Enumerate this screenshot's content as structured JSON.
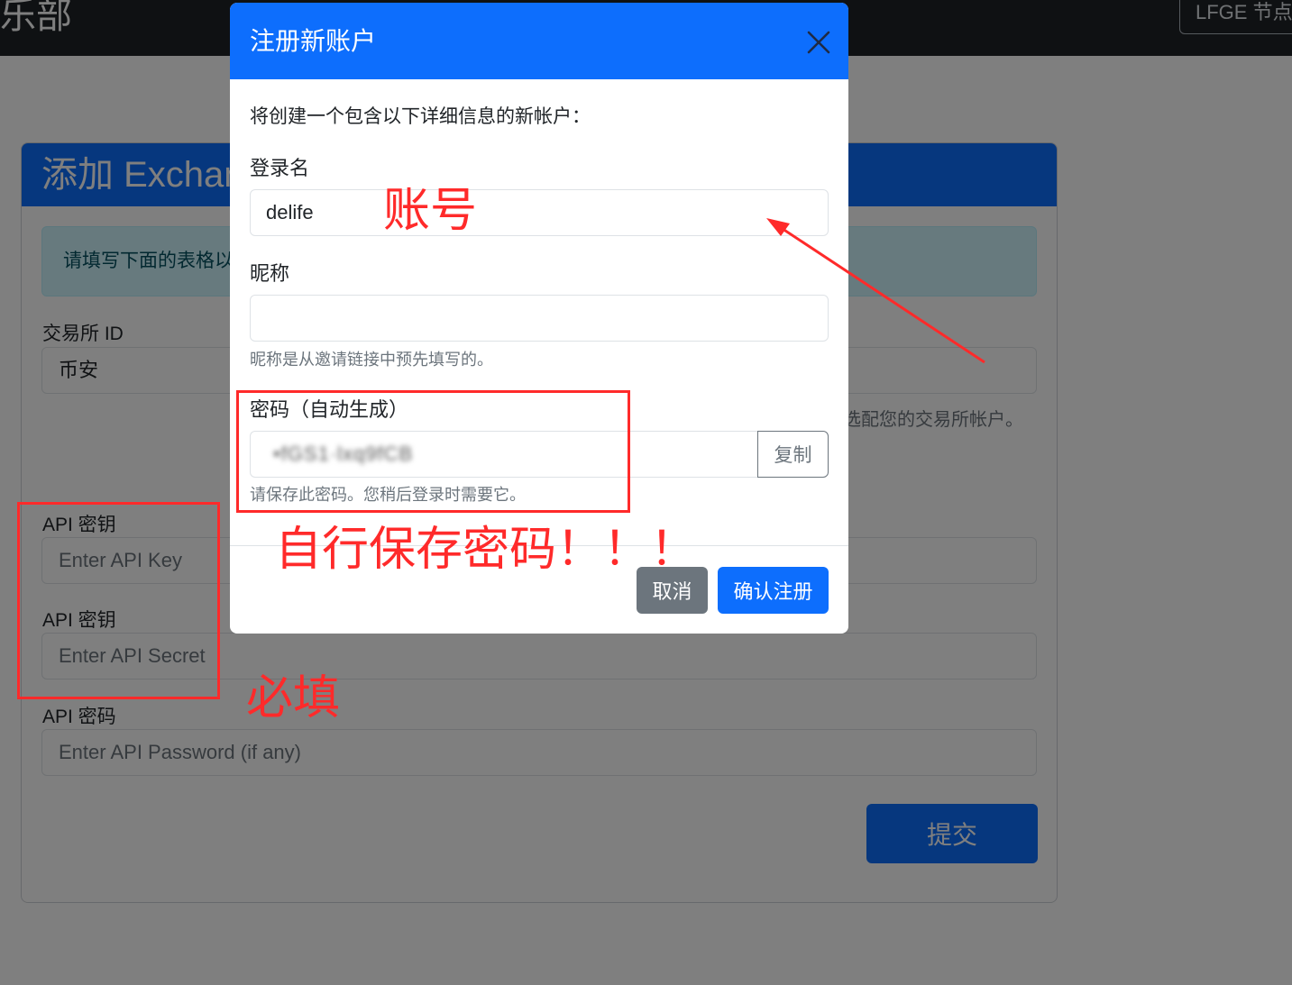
{
  "navbar": {
    "brand": "乐部",
    "right_button": "LFGE 节点登"
  },
  "card": {
    "header": "添加 Exchange",
    "alert": "请填写下面的表格以",
    "fields": [
      {
        "label": "交易所 ID",
        "value": "币安",
        "placeholder": ""
      },
      {
        "label": "API 密钥",
        "value": "",
        "placeholder": "Enter API Key"
      },
      {
        "label": "API 密钥",
        "value": "",
        "placeholder": "Enter API Secret"
      },
      {
        "label": "API 密码",
        "value": "",
        "placeholder": "Enter API Password (if any)"
      }
    ],
    "help_exchange": "选配您的交易所帐户。",
    "submit": "提交"
  },
  "modal": {
    "title": "注册新账户",
    "intro": "将创建一个包含以下详细信息的新帐户：",
    "login_label": "登录名",
    "login_value": "delife",
    "nickname_label": "昵称",
    "nickname_value": "",
    "nickname_help": "昵称是从邀请链接中预先填写的。",
    "password_label": "密码（自动生成）",
    "password_value": "•fGS1·lxq9fCB",
    "copy": "复制",
    "password_help": "请保存此密码。您稍后登录时需要它。",
    "cancel": "取消",
    "confirm": "确认注册"
  },
  "annotations": {
    "account": "账号",
    "save_password": "自行保存密码！！！",
    "required": "必填",
    "color": "#ff2a2a"
  },
  "colors": {
    "primary": "#0d6efd",
    "secondary": "#6c757d",
    "navbar": "#1f2226",
    "alert_bg": "#cff4fc"
  }
}
